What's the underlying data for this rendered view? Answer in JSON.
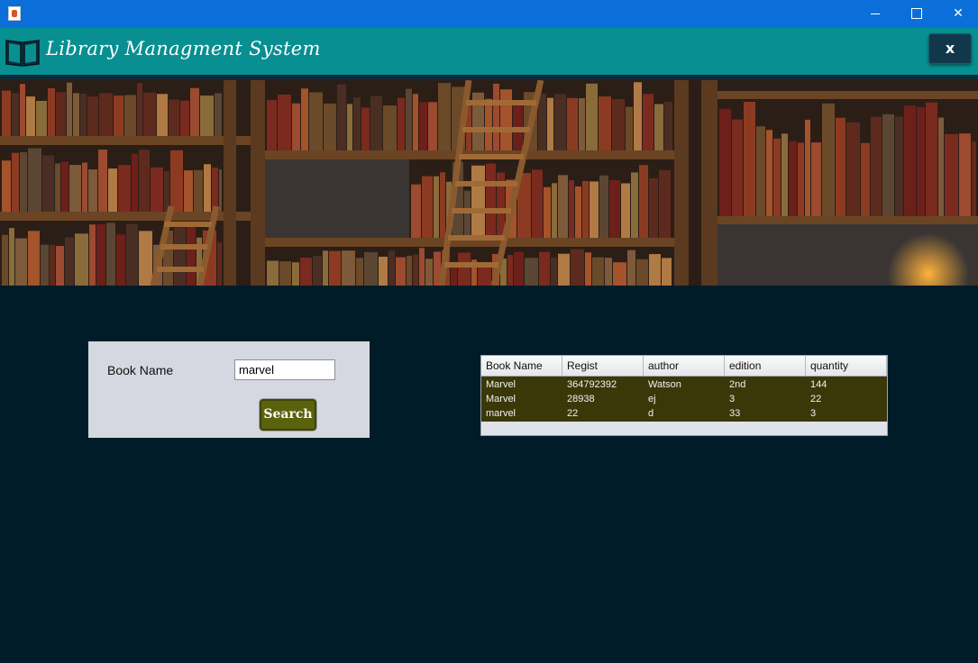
{
  "window": {
    "controls": {
      "minimize_icon": "minimize-icon",
      "maximize_icon": "maximize-icon",
      "close_icon": "close-icon",
      "close_glyph": "✕"
    }
  },
  "header": {
    "title": "Library Managment System",
    "icon": "open-book-icon",
    "exit_label": "x"
  },
  "search": {
    "label": "Book Name",
    "input_value": "marvel",
    "button_label": "Search"
  },
  "results": {
    "columns": [
      "Book Name",
      "Regist",
      "author",
      "edition",
      "quantity"
    ],
    "rows": [
      [
        "Marvel",
        "364792392",
        "Watson",
        "2nd",
        "144"
      ],
      [
        "Marvel",
        "28938",
        "ej",
        "3",
        "22"
      ],
      [
        "marvel",
        "22",
        "d",
        "33",
        "3"
      ]
    ]
  },
  "colors": {
    "title_bar": "#0a6fd8",
    "header": "#078f91",
    "background": "#001c29",
    "table_rows": "#3a3808",
    "search_button": "#5a620c"
  }
}
